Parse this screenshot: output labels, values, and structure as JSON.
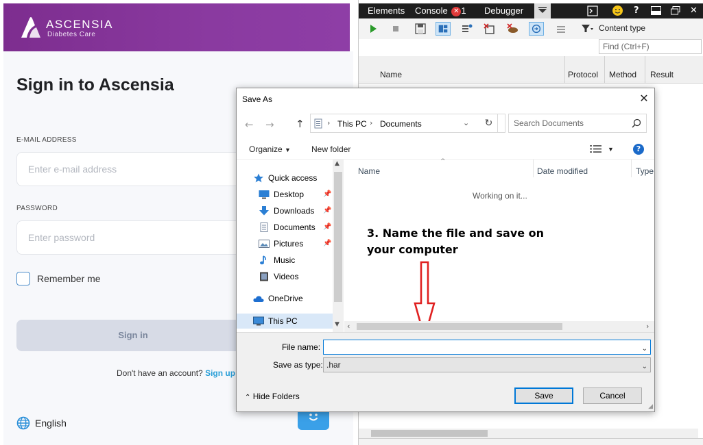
{
  "webpage": {
    "brand_name": "ASCENSIA",
    "brand_sub": "Diabetes Care",
    "title": "Sign in to Ascensia",
    "email_label": "E-MAIL ADDRESS",
    "email_placeholder": "Enter e-mail address",
    "password_label": "PASSWORD",
    "password_placeholder": "Enter password",
    "remember_label": "Remember me",
    "signin_label": "Sign in",
    "no_account_text": "Don't have an account?",
    "signup_label": "Sign up",
    "language_label": "English",
    "brand_color": "#8a3aa0",
    "link_color": "#2a9fd8"
  },
  "devtools": {
    "tabs": [
      "Elements",
      "Console",
      "Debugger"
    ],
    "console_error_count": "1",
    "content_type_label": "Content type",
    "find_placeholder": "Find (Ctrl+F)",
    "columns": [
      "Name",
      "Protocol",
      "Method",
      "Result"
    ],
    "icons": [
      "play-icon",
      "stop-icon",
      "save-icon",
      "import-icon",
      "clear-icon",
      "clear-cache-icon",
      "clear-cookies-icon",
      "always-refresh-icon",
      "filter-icon"
    ]
  },
  "dialog": {
    "title": "Save As",
    "breadcrumb": [
      "This PC",
      "Documents"
    ],
    "search_placeholder": "Search Documents",
    "organize_label": "Organize",
    "new_folder_label": "New folder",
    "tree": [
      {
        "label": "Quick access",
        "icon": "star-icon",
        "pinned": false
      },
      {
        "label": "Desktop",
        "icon": "desktop-icon",
        "pinned": true
      },
      {
        "label": "Downloads",
        "icon": "download-icon",
        "pinned": true
      },
      {
        "label": "Documents",
        "icon": "document-icon",
        "pinned": true
      },
      {
        "label": "Pictures",
        "icon": "picture-icon",
        "pinned": true
      },
      {
        "label": "Music",
        "icon": "music-icon",
        "pinned": false
      },
      {
        "label": "Videos",
        "icon": "video-icon",
        "pinned": false
      },
      {
        "label": "OneDrive",
        "icon": "cloud-icon",
        "pinned": false
      },
      {
        "label": "This PC",
        "icon": "computer-icon",
        "pinned": false
      }
    ],
    "columns": [
      "Name",
      "Date modified",
      "Type"
    ],
    "working_text": "Working on it...",
    "annotation": "3. Name the file and save on your computer",
    "file_name_label": "File name:",
    "file_name_value": "",
    "save_type_label": "Save as type:",
    "save_type_value": ".har",
    "hide_folders_label": "Hide Folders",
    "save_label": "Save",
    "cancel_label": "Cancel",
    "accent_color": "#0078d7",
    "annotation_arrow_color": "#e02020"
  }
}
